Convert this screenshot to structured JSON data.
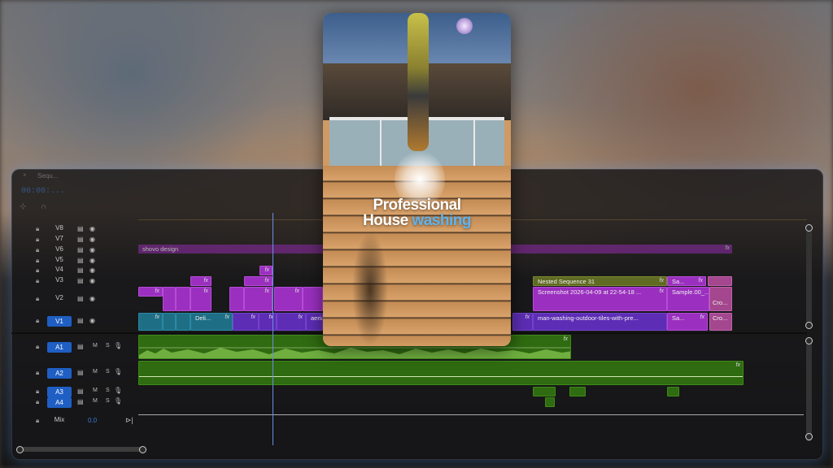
{
  "sequence": {
    "tab_title": "Sequ...",
    "close_glyph": "×",
    "timecode": "00:00:..."
  },
  "video_tracks": [
    {
      "name": "V8"
    },
    {
      "name": "V7"
    },
    {
      "name": "V6"
    },
    {
      "name": "V5"
    },
    {
      "name": "V4"
    },
    {
      "name": "V3"
    },
    {
      "name": "V2"
    },
    {
      "name": "V1",
      "selected": true
    }
  ],
  "audio_tracks": [
    {
      "name": "A1",
      "m": "M",
      "s": "S"
    },
    {
      "name": "A2",
      "m": "M",
      "s": "S"
    },
    {
      "name": "A3",
      "m": "M",
      "s": "S"
    },
    {
      "name": "A4",
      "m": "M",
      "s": "S"
    }
  ],
  "mix": {
    "label": "Mix",
    "value": "0.0"
  },
  "clips": {
    "fx": "fx",
    "shovo": "shovo design",
    "nested": "Nested Sequence 31",
    "screenshot": "Screenshot 2026-04-09 at 22-54-18 ...",
    "sample": "Sample.00_...",
    "sa1": "Sa...",
    "sa2": "Sa...",
    "cro1": "Cro...",
    "cro2": "Cro...",
    "deli": "Deli...",
    "aerial": "aeria",
    "man_washing": "man-washing-outdoor-tiles-with-pre..."
  },
  "preview": {
    "line1": "Professional",
    "line2_white": "House ",
    "line2_accent": "washing"
  },
  "colors": {
    "accent_blue": "#1f5fc4",
    "headline_accent": "#5fb4ee",
    "video_clip": "#9b2fbf",
    "audio_clip": "#2f6b10"
  }
}
